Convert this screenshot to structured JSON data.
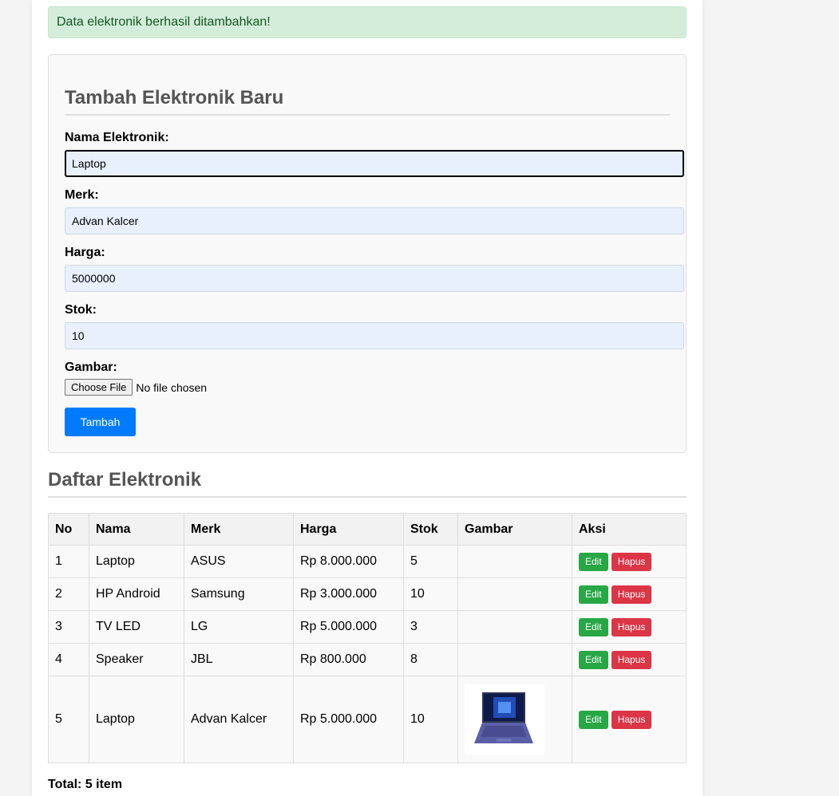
{
  "alert": {
    "message": "Data elektronik berhasil ditambahkan!"
  },
  "form": {
    "title": "Tambah Elektronik Baru",
    "fields": {
      "nama": {
        "label": "Nama Elektronik:",
        "value": "Laptop"
      },
      "merk": {
        "label": "Merk:",
        "value": "Advan Kalcer"
      },
      "harga": {
        "label": "Harga:",
        "value": "5000000"
      },
      "stok": {
        "label": "Stok:",
        "value": "10"
      },
      "gambar": {
        "label": "Gambar:",
        "button": "Choose File",
        "status": "No file chosen"
      }
    },
    "submit_label": "Tambah"
  },
  "list": {
    "title": "Daftar Elektronik",
    "headers": [
      "No",
      "Nama",
      "Merk",
      "Harga",
      "Stok",
      "Gambar",
      "Aksi"
    ],
    "rows": [
      {
        "no": "1",
        "nama": "Laptop",
        "merk": "ASUS",
        "harga": "Rp 8.000.000",
        "stok": "5"
      },
      {
        "no": "2",
        "nama": "HP Android",
        "merk": "Samsung",
        "harga": "Rp 3.000.000",
        "stok": "10"
      },
      {
        "no": "3",
        "nama": "TV LED",
        "merk": "LG",
        "harga": "Rp 5.000.000",
        "stok": "3"
      },
      {
        "no": "4",
        "nama": "Speaker",
        "merk": "JBL",
        "harga": "Rp 800.000",
        "stok": "8"
      },
      {
        "no": "5",
        "nama": "Laptop",
        "merk": "Advan Kalcer",
        "harga": "Rp 5.000.000",
        "stok": "10"
      }
    ],
    "actions": {
      "edit": "Edit",
      "hapus": "Hapus"
    },
    "total": "Total: 5 item"
  },
  "colors": {
    "alert_bg": "#d4edda",
    "alert_text": "#155724",
    "primary": "#007bff",
    "edit": "#28a745",
    "delete": "#dc3545"
  }
}
